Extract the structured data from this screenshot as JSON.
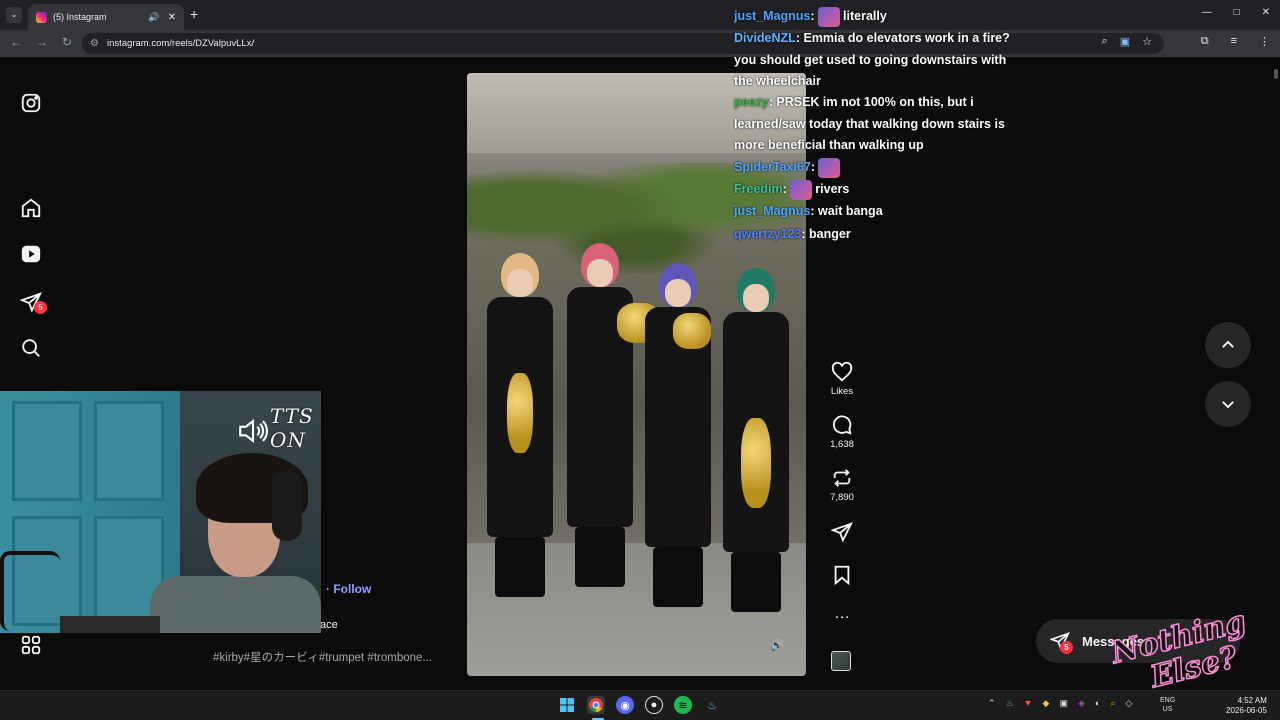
{
  "browser": {
    "tab_title": "(5) Instagram",
    "tab_list_glyph": "⌄",
    "tab_audio_glyph": "🔊",
    "tab_close_glyph": "✕",
    "new_tab_glyph": "+",
    "url": "instagram.com/reels/DZValpuvLLx/",
    "back_glyph": "←",
    "forward_glyph": "→",
    "reload_glyph": "↻",
    "minimize_glyph": "—",
    "maximize_glyph": "□",
    "close_glyph": "✕",
    "zoom_glyph": "⌕",
    "star_glyph": "☆",
    "extensions_glyph": "⧉",
    "menu_glyph": "⋮"
  },
  "sidebar": {
    "notification_count": "5"
  },
  "reel": {
    "likes_label": "Likes",
    "comments_count": "1,638",
    "reposts_count": "7,890",
    "more_glyph": "…",
    "sound_glyph": "🔊"
  },
  "caption": {
    "follow_label": "Follow",
    "username_partial": "ace",
    "hashtags": "#kirby#星のカービィ#trumpet #trombone..."
  },
  "messages": {
    "label": "Messages",
    "badge": "5"
  },
  "overlay": {
    "tts_line1": "TTS",
    "tts_line2": "ON",
    "logo_line1": "Nothing",
    "logo_line2": "Else?"
  },
  "chat": {
    "messages": [
      {
        "user": "just_Magnus",
        "color": "#4da6ff",
        "text": " literally",
        "emote": true
      },
      {
        "user": "DivideNZL",
        "color": "#5eb8ff",
        "text": " Emmia do elevators work in a fire? you should get used to going downstairs with the wheelchair",
        "emote": false
      },
      {
        "user": "peezy",
        "color": "#3cb043",
        "text": " PRSEK im not 100% on this, but i learned/saw today that walking down stairs is more beneficial than walking up",
        "emote": false
      },
      {
        "user": "SpiderTaxi67",
        "color": "#4da6ff",
        "text": " ",
        "emote": true
      },
      {
        "user": "Freedim",
        "color": "#3fbf9a",
        "text": " rivers",
        "emote": true
      },
      {
        "user": "just_Magnus",
        "color": "#4da6ff",
        "text": " wait banga",
        "emote": false
      },
      {
        "user": "qwertzy123",
        "color": "#4d7fff",
        "text": " banger",
        "emote": false
      }
    ]
  },
  "taskbar": {
    "lang_line1": "ENG",
    "lang_line2": "US",
    "time": "4:52 AM",
    "date": "2026-06-05",
    "tray_chevron": "⌃"
  },
  "colors": {
    "instagram_bg": "#0b0b0c",
    "chrome_bg": "#202124",
    "toolbar_bg": "#35363a",
    "badge_red": "#ff3040",
    "follow_blue": "#8ea2ff"
  }
}
